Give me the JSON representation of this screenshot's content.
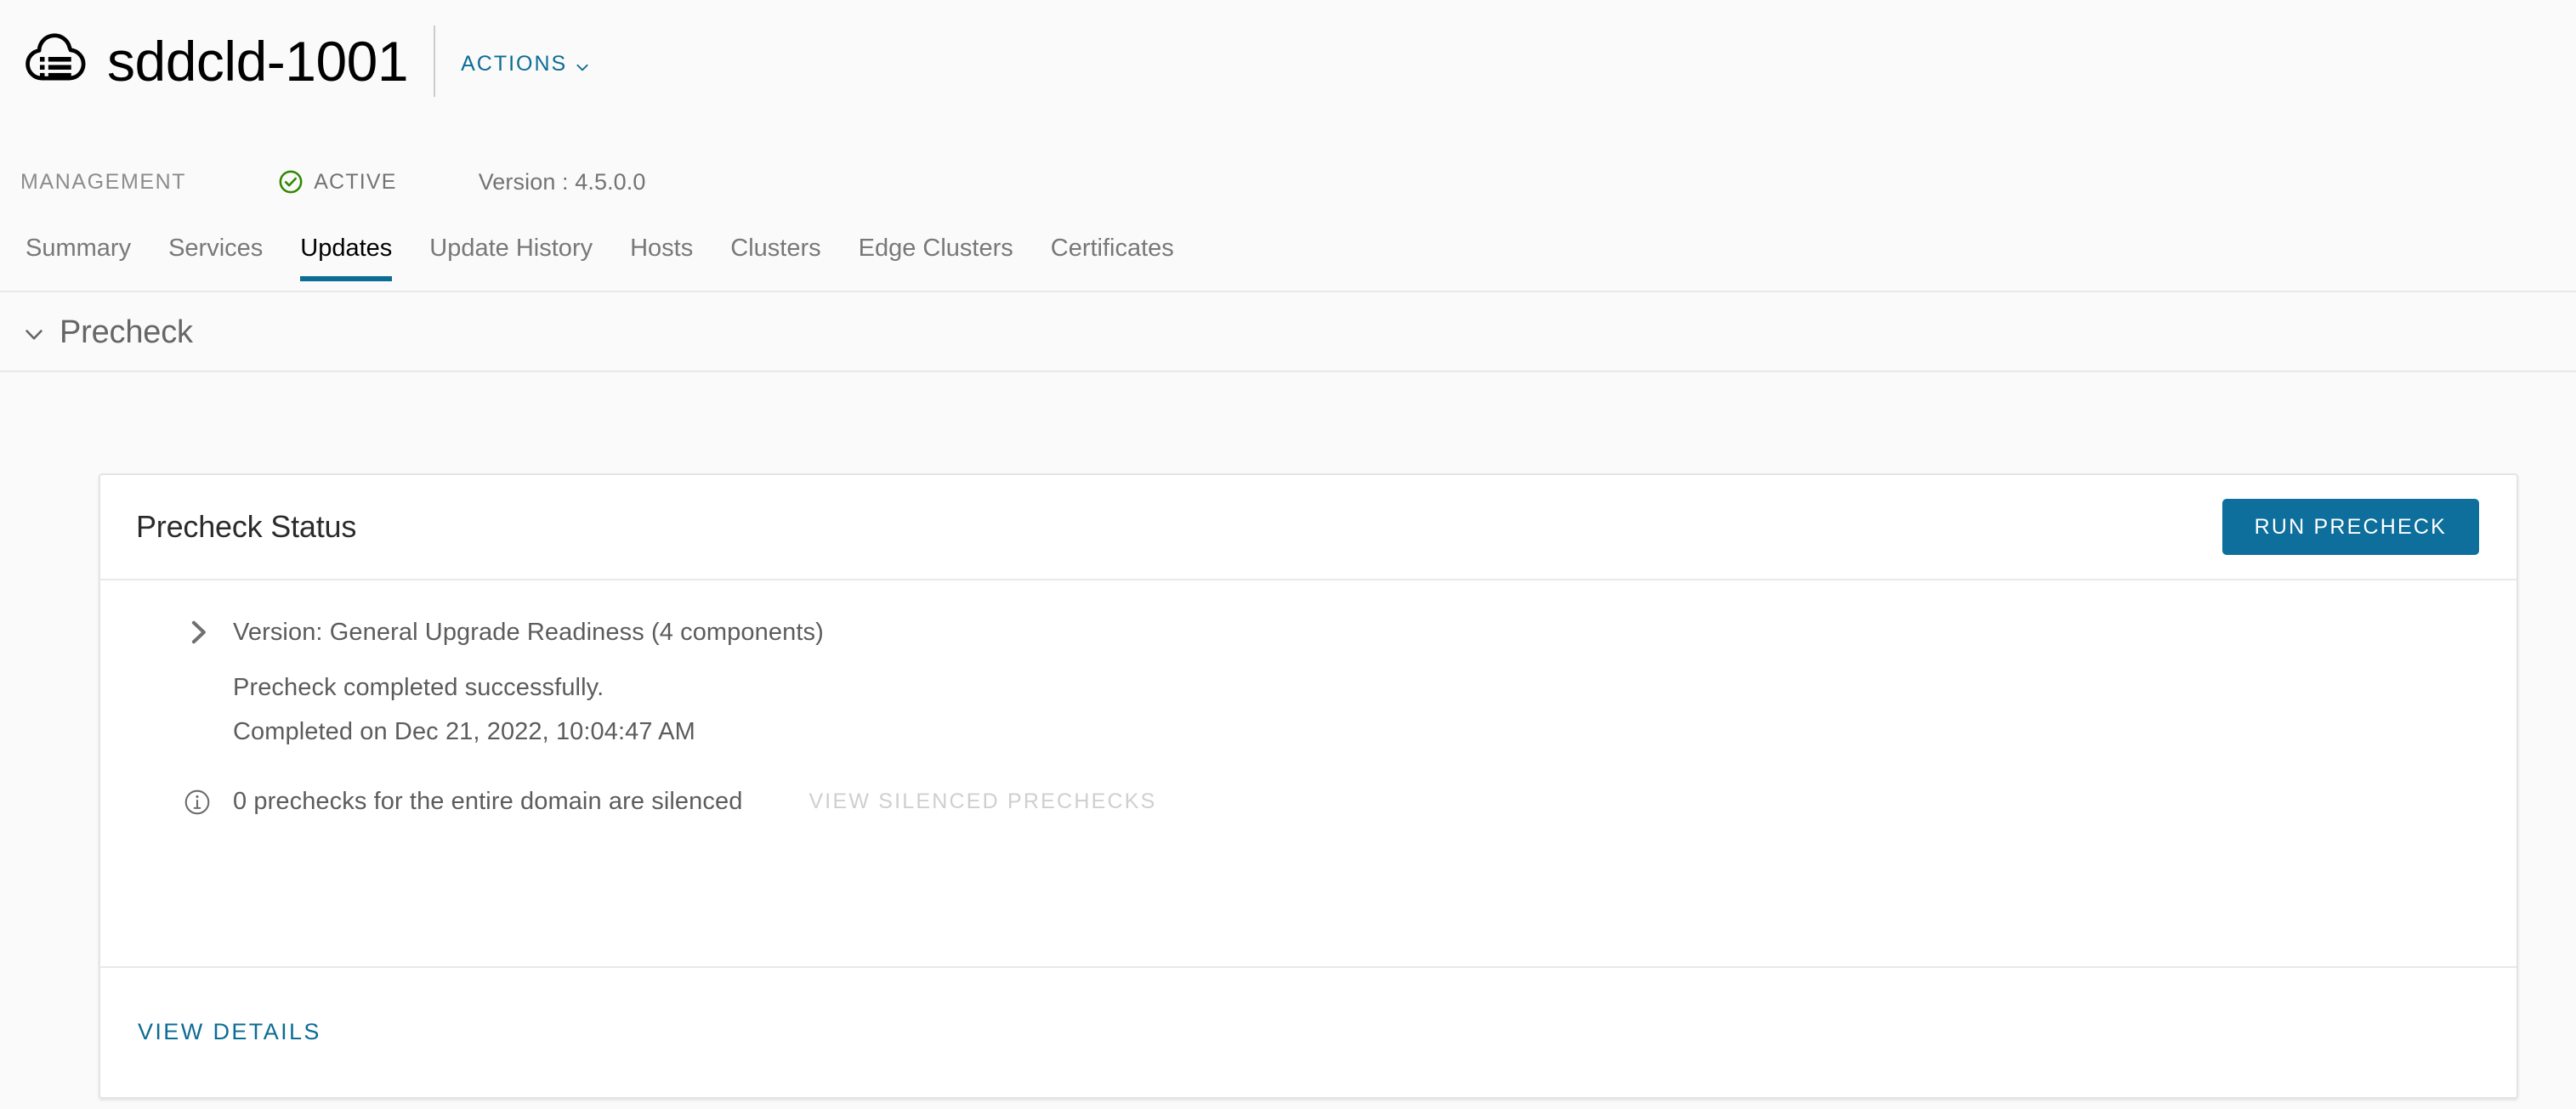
{
  "header": {
    "domain_icon": "cloud-domain-icon",
    "title": "sddcld-1001",
    "actions_label": "ACTIONS",
    "actions_caret": "chevron-down-icon",
    "meta": {
      "type": "MANAGEMENT",
      "status_icon": "success-check-circle-icon",
      "status": "ACTIVE",
      "version": "Version : 4.5.0.0"
    }
  },
  "tabs": [
    {
      "label": "Summary",
      "active": false
    },
    {
      "label": "Services",
      "active": false
    },
    {
      "label": "Updates",
      "active": true
    },
    {
      "label": "Update History",
      "active": false
    },
    {
      "label": "Hosts",
      "active": false
    },
    {
      "label": "Clusters",
      "active": false
    },
    {
      "label": "Edge Clusters",
      "active": false
    },
    {
      "label": "Certificates",
      "active": false
    }
  ],
  "section": {
    "caret_icon": "chevron-down-icon",
    "title": "Precheck"
  },
  "card": {
    "title": "Precheck Status",
    "run_button_label": "RUN PRECHECK",
    "readiness": {
      "caret_icon": "chevron-right-icon",
      "label": "Version: General Upgrade Readiness (4 components)"
    },
    "status_line_1": "Precheck completed successfully.",
    "status_line_2": "Completed on Dec 21, 2022, 10:04:47 AM",
    "silenced": {
      "info_icon": "info-circle-icon",
      "text": "0 prechecks for the entire domain are silenced",
      "link_label": "VIEW SILENCED PRECHECKS"
    },
    "view_details_label": "VIEW DETAILS"
  },
  "colors": {
    "accent_blue": "#0c6c95",
    "button_blue": "#0e6f9c",
    "status_green": "#318700",
    "page_bg": "#fafafa",
    "card_bg": "#ffffff",
    "border": "#e8e8e8",
    "text_muted": "#5c5c5c",
    "disabled": "#cfcfcf"
  }
}
